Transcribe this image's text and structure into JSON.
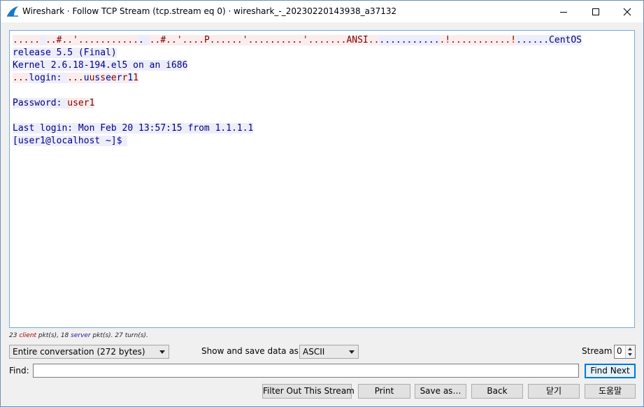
{
  "window": {
    "title": "Wireshark · Follow TCP Stream (tcp.stream eq 0) · wireshark_-_20230220143938_a37132",
    "icon": "wireshark-fin-icon",
    "controls": [
      "minimize-icon",
      "maximize-icon",
      "close-icon"
    ]
  },
  "stream": {
    "lines": [
      [
        {
          "who": "cli",
          "t": "....."
        },
        {
          "who": "srv",
          "t": " "
        },
        {
          "who": "cli",
          "t": "..#..'..........."
        },
        {
          "who": "srv",
          "t": ". "
        },
        {
          "who": "cli",
          "t": "..#..'....P......'..........'.......ANSI.."
        },
        {
          "who": "srv",
          "t": "..........."
        },
        {
          "who": "cli",
          "t": ".!...........!"
        },
        {
          "who": "srv",
          "t": "......CentOS"
        }
      ],
      [
        {
          "who": "srv",
          "t": "release 5.5 (Final)"
        }
      ],
      [
        {
          "who": "srv",
          "t": "Kernel 2.6.18-194.el5 on an i686"
        }
      ],
      [
        {
          "who": "cli",
          "t": "..."
        },
        {
          "who": "srv",
          "t": "login: "
        },
        {
          "who": "cli",
          "t": "..."
        },
        {
          "who": "srv",
          "t": "u"
        },
        {
          "who": "cli",
          "t": "u"
        },
        {
          "who": "srv",
          "t": "s"
        },
        {
          "who": "cli",
          "t": "s"
        },
        {
          "who": "srv",
          "t": "e"
        },
        {
          "who": "cli",
          "t": "e"
        },
        {
          "who": "srv",
          "t": "r"
        },
        {
          "who": "cli",
          "t": "r"
        },
        {
          "who": "srv",
          "t": "1"
        },
        {
          "who": "cli",
          "t": "1"
        }
      ],
      [
        {
          "who": "srv",
          "t": ""
        }
      ],
      [
        {
          "who": "srv",
          "t": "Password: "
        },
        {
          "who": "cli",
          "t": "user1"
        }
      ],
      [
        {
          "who": "srv",
          "t": ""
        }
      ],
      [
        {
          "who": "srv",
          "t": "Last login: Mon Feb 20 13:57:15 from 1.1.1.1"
        }
      ],
      [
        {
          "who": "srv",
          "t": "[user1@localhost ~]$ "
        }
      ]
    ]
  },
  "summary": {
    "client_count": "23",
    "client_word": "client",
    "mid1": " pkt(s), ",
    "server_count": "18",
    "server_word": "server",
    "tail": " pkt(s). 27 turn(s)."
  },
  "controls": {
    "conversation_select": "Entire conversation (272 bytes)",
    "show_save_label": "Show and save data as",
    "format_select": "ASCII",
    "stream_label": "Stream",
    "stream_value": "0",
    "find_label": "Find:",
    "find_value": "",
    "find_next": "Find Next",
    "filter_out": "Filter Out This Stream",
    "print": "Print",
    "save_as": "Save as…",
    "back": "Back",
    "close": "닫기",
    "help": "도움말"
  },
  "colors": {
    "client_fg": "#7f0000",
    "client_bg": "#fbeded",
    "server_fg": "#000080",
    "server_bg": "#ededfb",
    "accent": "#0078d7"
  }
}
